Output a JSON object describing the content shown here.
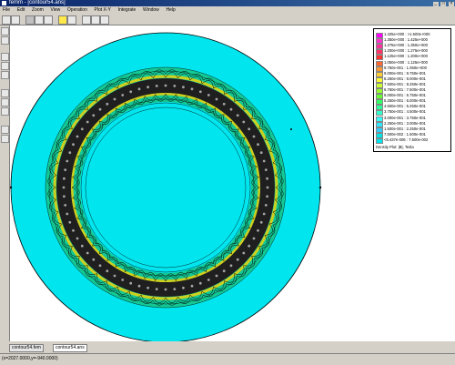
{
  "window": {
    "title": "femm - [contour54.ans]"
  },
  "menu": [
    "File",
    "Edit",
    "Zoom",
    "View",
    "Operation",
    "Plot X-Y",
    "Integrate",
    "Window",
    "Help"
  ],
  "toolbar": {
    "buttons": [
      "new-icon",
      "open-icon",
      "pointer-icon",
      "zoom-icon",
      "contour-icon",
      "density-icon",
      "vector-icon",
      "grid-icon",
      "table-icon",
      "settings-icon"
    ]
  },
  "legend": {
    "entries": [
      {
        "label": "1.425e+000 : >1.500e+000",
        "color": "#ff00ff"
      },
      {
        "label": "1.350e+000 : 1.425e+000",
        "color": "#ff33cc"
      },
      {
        "label": "1.275e+000 : 1.350e+000",
        "color": "#ff3399"
      },
      {
        "label": "1.200e+000 : 1.275e+000",
        "color": "#ff3366"
      },
      {
        "label": "1.125e+000 : 1.200e+000",
        "color": "#ff3333"
      },
      {
        "label": "1.050e+000 : 1.125e+000",
        "color": "#ff6633"
      },
      {
        "label": "9.750e-001 : 1.050e+000",
        "color": "#ff9933"
      },
      {
        "label": "9.000e-001 : 9.750e-001",
        "color": "#ffcc33"
      },
      {
        "label": "8.250e-001 : 9.000e-001",
        "color": "#ffff33"
      },
      {
        "label": "7.500e-001 : 8.250e-001",
        "color": "#ccff33"
      },
      {
        "label": "6.750e-001 : 7.500e-001",
        "color": "#99ff33"
      },
      {
        "label": "6.000e-001 : 6.750e-001",
        "color": "#66ff33"
      },
      {
        "label": "5.250e-001 : 6.000e-001",
        "color": "#33ff66"
      },
      {
        "label": "4.500e-001 : 5.250e-001",
        "color": "#33ff99"
      },
      {
        "label": "3.750e-001 : 4.500e-001",
        "color": "#33ffcc"
      },
      {
        "label": "3.000e-001 : 3.750e-001",
        "color": "#33ffff"
      },
      {
        "label": "2.250e-001 : 3.000e-001",
        "color": "#33e6ff"
      },
      {
        "label": "1.500e-001 : 2.250e-001",
        "color": "#33ccff"
      },
      {
        "label": "7.500e-002 : 1.500e-001",
        "color": "#00e6e6"
      },
      {
        "label": "<5.437e-006 : 7.500e-002",
        "color": "#00e5ee"
      }
    ],
    "caption": "Density Plot: |B|, Tesla"
  },
  "tabs": [
    {
      "label": "contour54.fem",
      "active": false
    },
    {
      "label": "contour54.ans",
      "active": true
    }
  ],
  "status": {
    "text": "(x=2027.0000,y=-940.0000)"
  },
  "colors": {
    "background": "#00e5ee",
    "contour": "#000000",
    "ring": "#1f1f1f",
    "green": "#22b14c",
    "yellow": "#ffd200",
    "orange": "#ff8c00"
  }
}
